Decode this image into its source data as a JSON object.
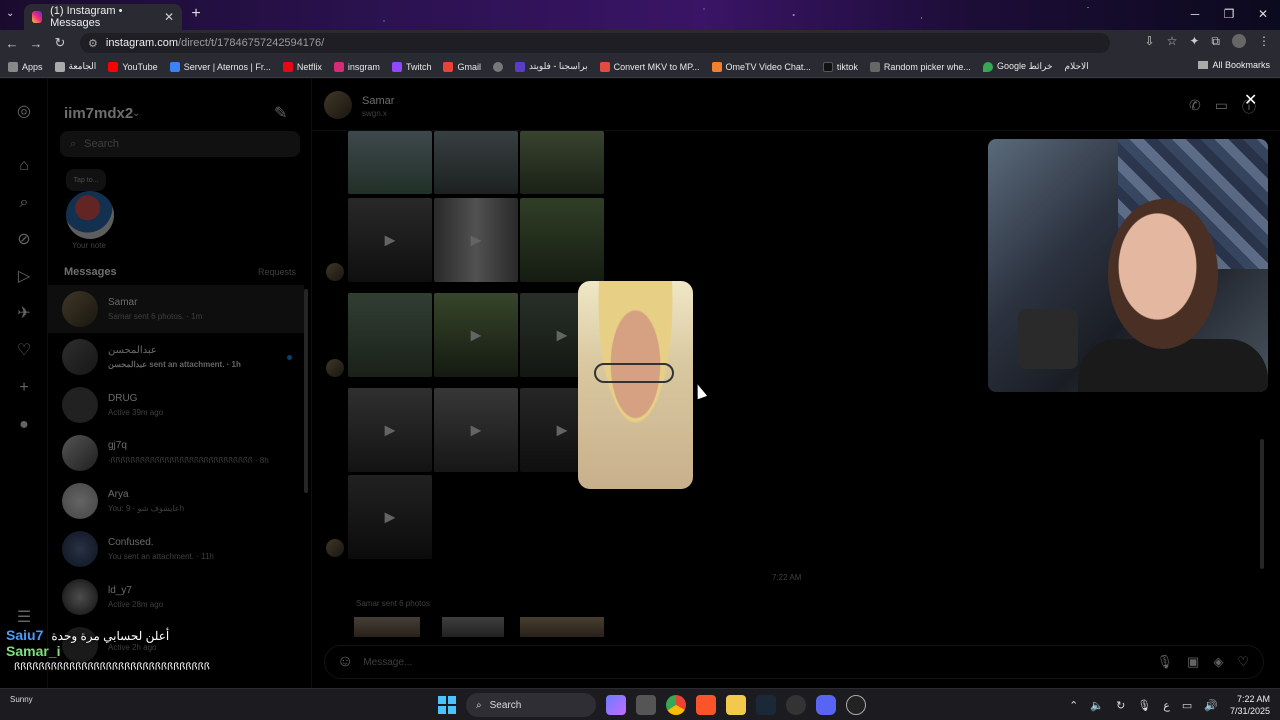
{
  "browser": {
    "tab_title": "(1) Instagram • Messages",
    "url_host": "instagram.com",
    "url_path": "/direct/t/17846757242594176/",
    "bookmarks": [
      "Apps",
      "الجامعة",
      "YouTube",
      "Server | Aternos | Fr...",
      "Netflix",
      "insgram",
      "Twitch",
      "Gmail",
      "براسجنا - فلويتد",
      "Convert MKV to MP...",
      "OmeTV Video Chat...",
      "tiktok",
      "Random picker whe...",
      "Google خرائط",
      "الاحلام"
    ],
    "all_bookmarks": "All Bookmarks"
  },
  "inbox": {
    "account": "iim7mdx2",
    "search_placeholder": "Search",
    "note_bubble": "Tap to...",
    "note_label": "Your note",
    "messages_heading": "Messages",
    "requests_label": "Requests",
    "threads": [
      {
        "name": "Samar",
        "sub": "Samar sent 6 photos. · 1m"
      },
      {
        "name": "عبدالمحسن",
        "sub": "عبدالمحسن sent an attachment. · 1h"
      },
      {
        "name": "DRUG",
        "sub": "Active 39m ago"
      },
      {
        "name": "gj7q",
        "sub": "·ꟗꟗꟗꟗꟗꟗꟗꟗꟗꟗꟗꟗꟗꟗꟗꟗꟗꟗꟗꟗꟗꟗꟗꟗꟗꟗꟗꟗꟗ · 8h"
      },
      {
        "name": "Arya",
        "sub": "You: عايشوف شو · 9h"
      },
      {
        "name": "Confused.",
        "sub": "You sent an attachment. · 11h"
      },
      {
        "name": "ld_y7",
        "sub": "Active 28m ago"
      },
      {
        "name": "",
        "sub": "Active 2h ago"
      }
    ]
  },
  "chat": {
    "name": "Samar",
    "username": "swgn.x",
    "timestamp": "7:22 AM",
    "sent_label": "Samar sent 6 photos",
    "composer_placeholder": "Message..."
  },
  "overlay_chat": [
    {
      "user": "Saiu7",
      "msg": "أعلن لحسابي مرة وحدة",
      "color": "#4a9cff"
    },
    {
      "user": "Samar_i",
      "msg": "",
      "color": "#7fe07f"
    },
    {
      "user": "",
      "msg": "ꟗꟗꟗꟗꟗꟗꟗꟗꟗꟗꟗꟗꟗꟗꟗꟗꟗꟗꟗꟗꟗꟗꟗꟗꟗꟗꟗꟗꟗꟗꟗꟗ",
      "color": "#ffffff"
    }
  ],
  "taskbar": {
    "weather": "Sunny",
    "search_label": "Search",
    "time": "7:22 AM",
    "date": "7/31/2025",
    "lang": "ع"
  }
}
